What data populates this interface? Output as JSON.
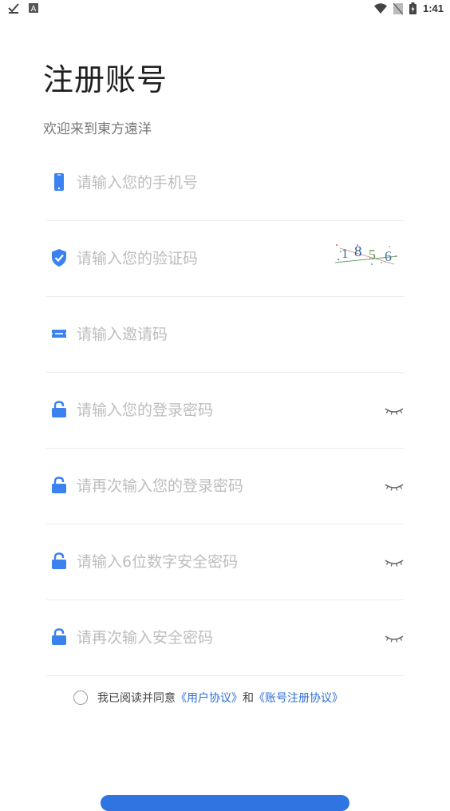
{
  "status_bar": {
    "time": "1:41",
    "left_icons": [
      "download-check-icon",
      "app-a-icon"
    ],
    "right_icons": [
      "wifi-icon",
      "no-sim-icon",
      "battery-charging-icon"
    ]
  },
  "header": {
    "title": "注册账号",
    "subtitle": "欢迎来到東方遠洋"
  },
  "form": {
    "fields": [
      {
        "icon": "phone-icon",
        "placeholder": "请输入您的手机号"
      },
      {
        "icon": "shield-check-icon",
        "placeholder": "请输入您的验证码",
        "captcha": "1856"
      },
      {
        "icon": "ticket-icon",
        "placeholder": "请输入邀请码"
      },
      {
        "icon": "lock-icon",
        "placeholder": "请输入您的登录密码"
      },
      {
        "icon": "lock-icon",
        "placeholder": "请再次输入您的登录密码"
      },
      {
        "icon": "lock-icon",
        "placeholder": "请输入6位数字安全密码"
      },
      {
        "icon": "lock-icon",
        "placeholder": "请再次输入安全密码"
      }
    ]
  },
  "agreement": {
    "prefix": "我已阅读并同意",
    "user_agreement": "《用户协议》",
    "and": "和",
    "register_agreement": "《账号注册协议》"
  },
  "colors": {
    "accent": "#2f74e0",
    "icon_blue": "#3b82f0",
    "placeholder": "#bdbdbd",
    "divider": "#ececec"
  }
}
